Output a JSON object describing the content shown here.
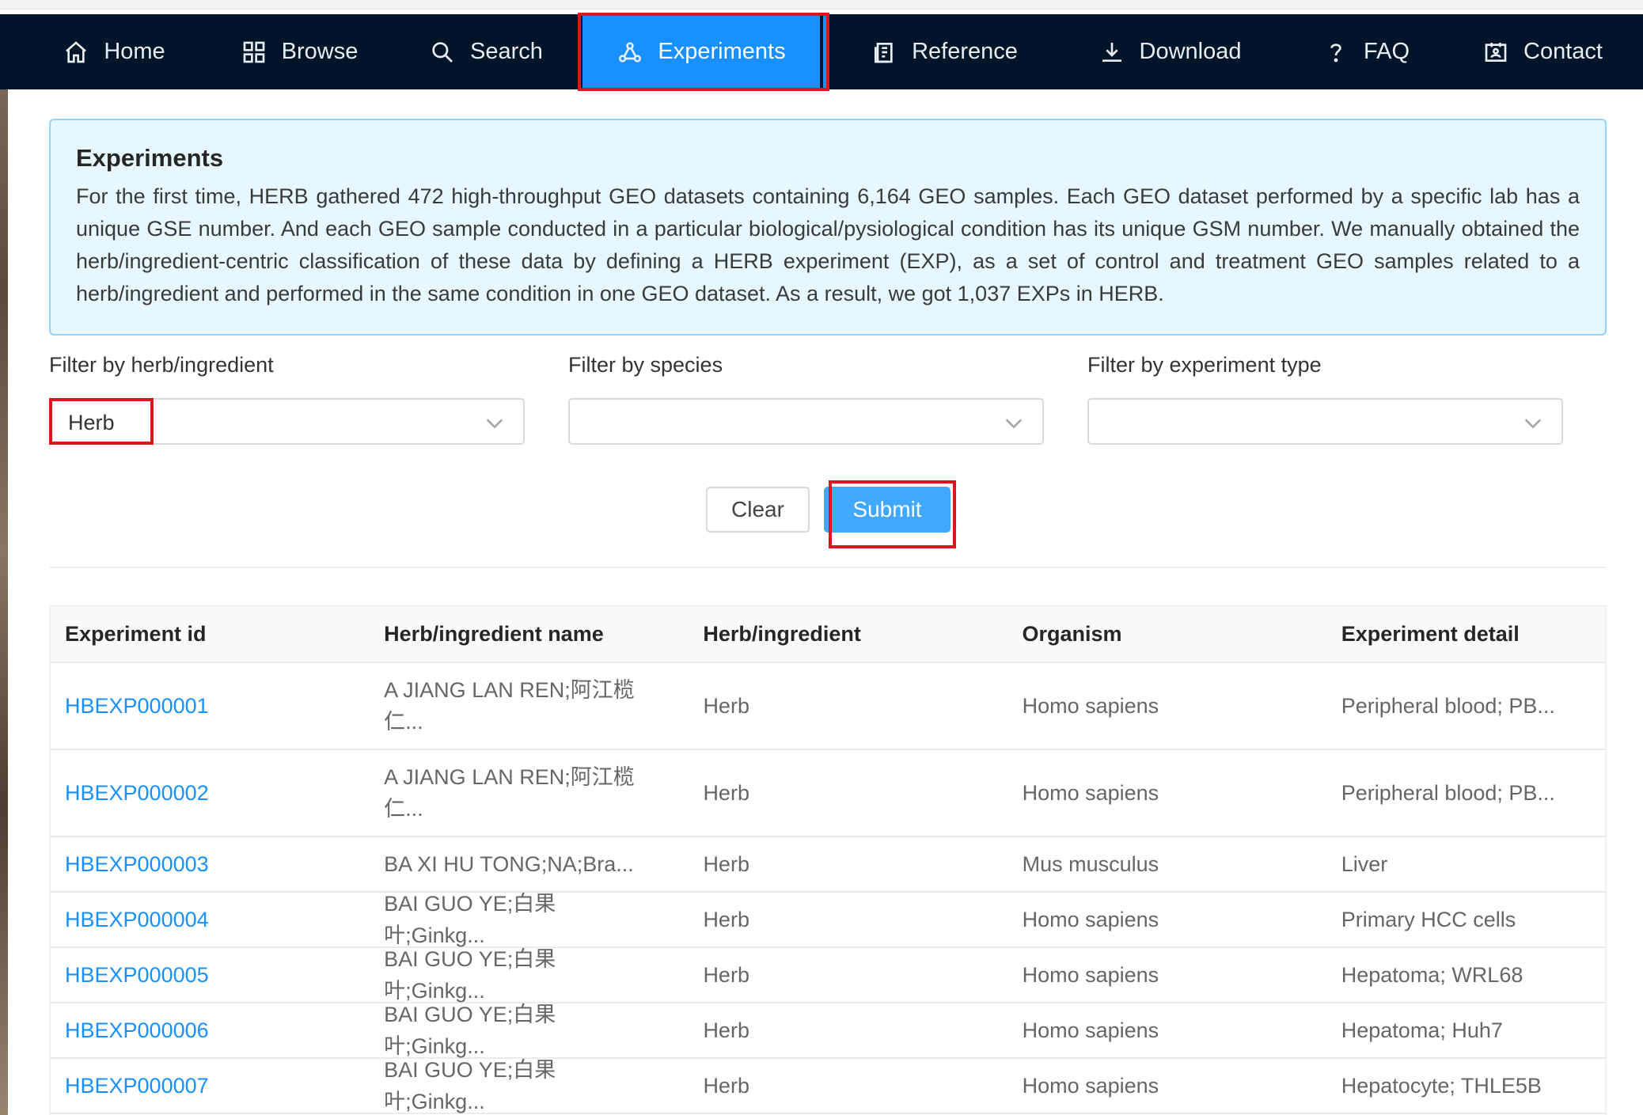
{
  "nav": {
    "items": [
      {
        "label": "Home",
        "icon": "home-icon"
      },
      {
        "label": "Browse",
        "icon": "grid-icon"
      },
      {
        "label": "Search",
        "icon": "search-icon"
      },
      {
        "label": "Experiments",
        "icon": "network-icon",
        "active": true
      },
      {
        "label": "Reference",
        "icon": "document-icon"
      },
      {
        "label": "Download",
        "icon": "download-icon"
      },
      {
        "label": "FAQ",
        "icon": "question-icon"
      },
      {
        "label": "Contact",
        "icon": "contact-card-icon"
      }
    ]
  },
  "intro": {
    "title": "Experiments",
    "text": "For the first time, HERB gathered 472 high-throughput GEO datasets containing 6,164 GEO samples. Each GEO dataset performed by a specific lab has a unique GSE number. And each GEO sample conducted in a particular biological/pysiological condition has its unique GSM number. We manually obtained the herb/ingredient-centric classification of these data by defining a HERB experiment (EXP), as a set of control and treatment GEO samples related to a herb/ingredient and performed in the same condition in one GEO dataset. As a result, we got 1,037 EXPs in HERB."
  },
  "filters": {
    "herb_label": "Filter by herb/ingredient",
    "herb_value": "Herb",
    "species_label": "Filter by species",
    "species_value": "",
    "type_label": "Filter by experiment type",
    "type_value": ""
  },
  "buttons": {
    "clear": "Clear",
    "submit": "Submit"
  },
  "table": {
    "headers": [
      "Experiment id",
      "Herb/ingredient name",
      "Herb/ingredient",
      "Organism",
      "Experiment detail"
    ],
    "rows": [
      [
        "HBEXP000001",
        "A JIANG LAN REN;阿江榄仁...",
        "Herb",
        "Homo sapiens",
        "Peripheral blood; PB..."
      ],
      [
        "HBEXP000002",
        "A JIANG LAN REN;阿江榄仁...",
        "Herb",
        "Homo sapiens",
        "Peripheral blood; PB..."
      ],
      [
        "HBEXP000003",
        "BA XI HU TONG;NA;Bra...",
        "Herb",
        "Mus musculus",
        "Liver"
      ],
      [
        "HBEXP000004",
        "BAI GUO YE;白果叶;Ginkg...",
        "Herb",
        "Homo sapiens",
        "Primary HCC cells"
      ],
      [
        "HBEXP000005",
        "BAI GUO YE;白果叶;Ginkg...",
        "Herb",
        "Homo sapiens",
        "Hepatoma; WRL68"
      ],
      [
        "HBEXP000006",
        "BAI GUO YE;白果叶;Ginkg...",
        "Herb",
        "Homo sapiens",
        "Hepatoma; Huh7"
      ],
      [
        "HBEXP000007",
        "BAI GUO YE;白果叶;Ginkg...",
        "Herb",
        "Homo sapiens",
        "Hepatocyte; THLE5B"
      ]
    ]
  },
  "colors": {
    "nav_bg": "#001529",
    "active": "#1890ff",
    "highlight": "#e0141e",
    "link": "#1890ff"
  }
}
